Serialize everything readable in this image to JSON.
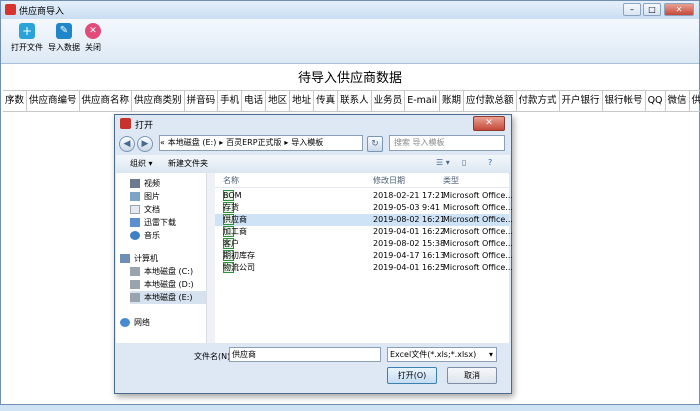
{
  "window": {
    "title": "供应商导入",
    "btn_min": "–",
    "btn_max": "□",
    "btn_close": "✕"
  },
  "toolbar": {
    "open_label": "打开文件",
    "import_label": "导入数据",
    "close_label": "关闭"
  },
  "main": {
    "heading": "待导入供应商数据",
    "columns": [
      "序数",
      "供应商编号",
      "供应商名称",
      "供应商类别",
      "拼音码",
      "手机",
      "电话",
      "地区",
      "地址",
      "传真",
      "联系人",
      "业务员",
      "E-mail",
      "账期",
      "应付款总额",
      "付款方式",
      "开户银行",
      "银行帐号",
      "QQ",
      "微信",
      "供应商"
    ]
  },
  "dialog": {
    "title": "打开",
    "close_label": "✕",
    "path": [
      "«",
      "本地磁盘 (E:)",
      "▸",
      "百灵ERP正式版",
      "▸",
      "导入模板"
    ],
    "search_placeholder": "搜索 导入模板",
    "cmd": {
      "organize": "组织 ▾",
      "new_folder": "新建文件夹"
    },
    "nav": [
      {
        "label": "视频"
      },
      {
        "label": "图片"
      },
      {
        "label": "文档"
      },
      {
        "label": "迅雷下载"
      },
      {
        "label": "音乐"
      },
      {
        "label": "计算机"
      },
      {
        "label": "本地磁盘 (C:)"
      },
      {
        "label": "本地磁盘 (D:)"
      },
      {
        "label": "本地磁盘 (E:)"
      },
      {
        "label": "网络"
      }
    ],
    "list_headers": {
      "name": "名称",
      "date": "修改日期",
      "type": "类型"
    },
    "files": [
      {
        "name": "BOM",
        "date": "2018-02-21 17:21",
        "type": "Microsoft Office..."
      },
      {
        "name": "存货",
        "date": "2019-05-03 9:41",
        "type": "Microsoft Office..."
      },
      {
        "name": "供应商",
        "date": "2019-08-02 16:21",
        "type": "Microsoft Office..."
      },
      {
        "name": "加工商",
        "date": "2019-04-01 16:22",
        "type": "Microsoft Office..."
      },
      {
        "name": "客户",
        "date": "2019-08-02 15:38",
        "type": "Microsoft Office..."
      },
      {
        "name": "期初库存",
        "date": "2019-04-17 16:13",
        "type": "Microsoft Office..."
      },
      {
        "name": "物流公司",
        "date": "2019-04-01 16:25",
        "type": "Microsoft Office..."
      }
    ],
    "filename_label": "文件名(N):",
    "filename_value": "供应商",
    "filetype_value": "Excel文件(*.xls;*.xlsx)",
    "open_button": "打开(O)",
    "cancel_button": "取消"
  }
}
